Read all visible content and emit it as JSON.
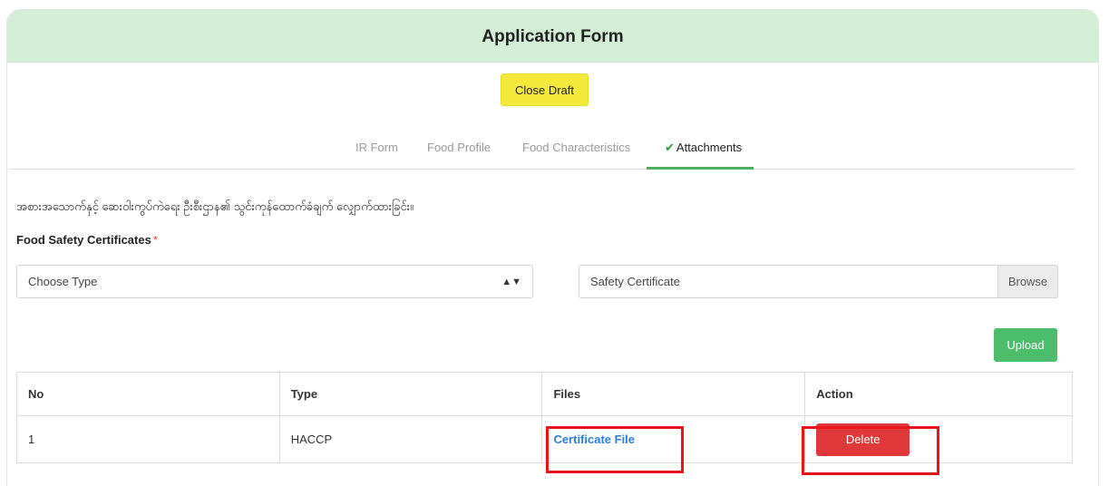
{
  "header": {
    "title": "Application Form"
  },
  "toolbar": {
    "close_draft_label": "Close Draft"
  },
  "tabs": [
    {
      "label": "IR Form",
      "active": false
    },
    {
      "label": "Food Profile",
      "active": false
    },
    {
      "label": "Food Characteristics",
      "active": false
    },
    {
      "label": "Attachments",
      "active": true,
      "icon": "check-icon"
    }
  ],
  "instruction_text": "အစားအသောက်နှင့် ဆေးဝါးကွပ်ကဲရေး ဦးစီးဌာန၏ သွင်းကုန်ထောက်ခံချက် လျှောက်ထားခြင်း။",
  "certificates": {
    "label": "Food Safety Certificates",
    "required_mark": "*",
    "type_select": {
      "value": "Choose Type"
    },
    "file_input": {
      "placeholder": "Safety Certificate"
    },
    "browse_label": "Browse",
    "upload_label": "Upload"
  },
  "table": {
    "headers": [
      "No",
      "Type",
      "Files",
      "Action"
    ],
    "rows": [
      {
        "no": "1",
        "type": "HACCP",
        "file": "Certificate File",
        "action": "Delete"
      }
    ]
  },
  "colors": {
    "header_bg": "#d3efd6",
    "close_draft_bg": "#f5e93b",
    "tab_active_underline": "#4cae5b",
    "upload_bg": "#4cbd6b",
    "delete_bg": "#e0393b",
    "link": "#2b7fd6",
    "highlight": "#e8141a"
  }
}
